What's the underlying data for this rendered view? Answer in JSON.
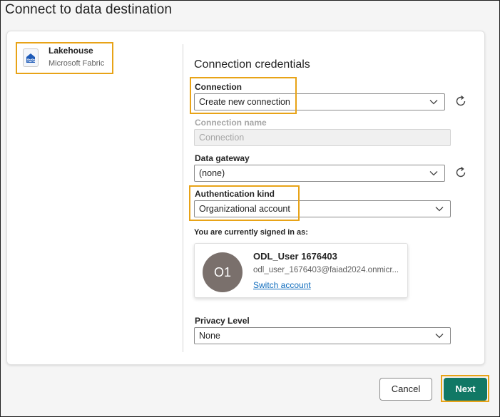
{
  "dialog": {
    "title": "Connect to data destination"
  },
  "destination": {
    "name": "Lakehouse",
    "provider": "Microsoft Fabric",
    "icon": "lakehouse-icon"
  },
  "credentials": {
    "section_title": "Connection credentials",
    "connection": {
      "label": "Connection",
      "value": "Create new connection"
    },
    "connection_name": {
      "label": "Connection name",
      "placeholder": "Connection"
    },
    "data_gateway": {
      "label": "Data gateway",
      "value": "(none)"
    },
    "auth_kind": {
      "label": "Authentication kind",
      "value": "Organizational account"
    },
    "signed_in_label": "You are currently signed in as:",
    "account": {
      "initials": "O1",
      "name": "ODL_User 1676403",
      "email": "odl_user_1676403@faiad2024.onmicr...",
      "switch_label": "Switch account"
    },
    "privacy_level": {
      "label": "Privacy Level",
      "value": "None"
    }
  },
  "buttons": {
    "cancel": "Cancel",
    "next": "Next"
  },
  "colors": {
    "accent": "#117865",
    "highlight": "#e8a317",
    "link": "#0f6cbd",
    "avatar": "#7a706c"
  }
}
